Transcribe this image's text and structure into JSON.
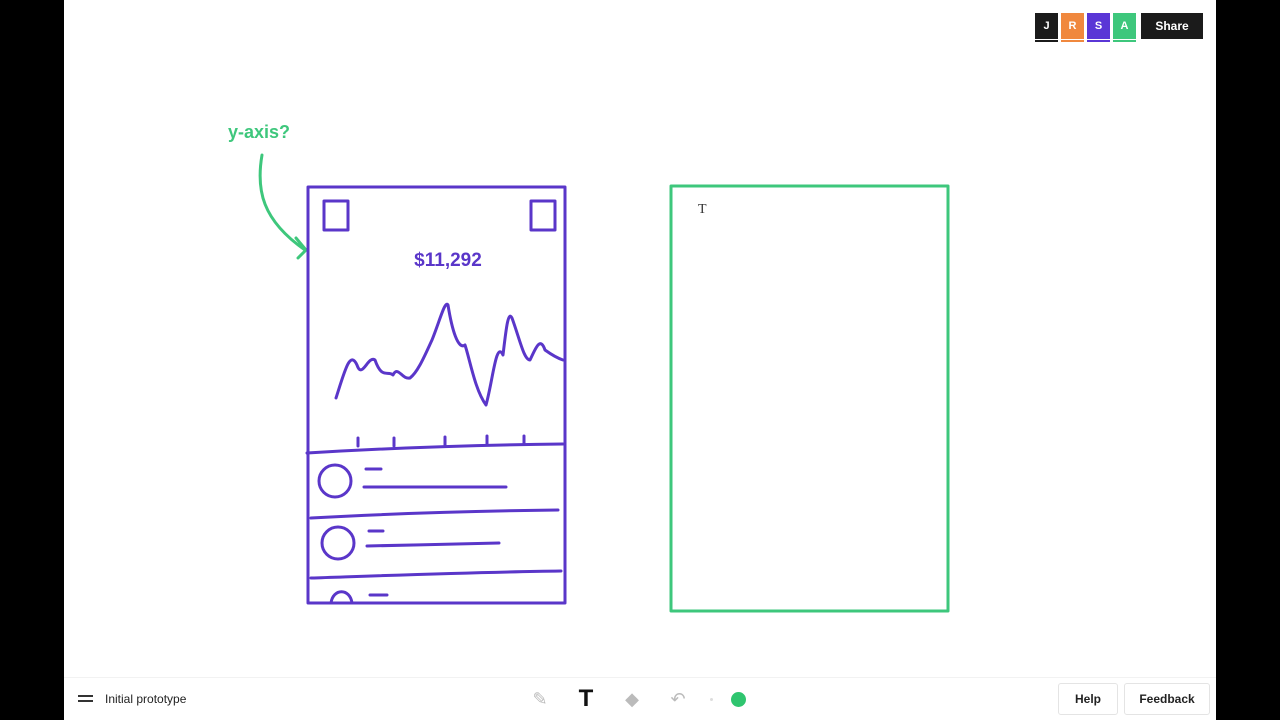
{
  "collaborators": [
    {
      "initial": "J",
      "color": "#1b1b1b"
    },
    {
      "initial": "R",
      "color": "#f0883e"
    },
    {
      "initial": "S",
      "color": "#5a36d6"
    },
    {
      "initial": "A",
      "color": "#3ec77c"
    }
  ],
  "share_label": "Share",
  "canvas": {
    "annotation": "y-axis?",
    "price": "$11,292",
    "sketch_color": "#5a36c9",
    "annotation_color": "#3ec77c",
    "text_cursor": "T"
  },
  "footer": {
    "document_title": "Initial prototype",
    "help_label": "Help",
    "feedback_label": "Feedback",
    "active_color": "#2fc56f",
    "tools": [
      "pencil-icon",
      "text-icon",
      "eraser-icon",
      "undo-icon"
    ]
  }
}
